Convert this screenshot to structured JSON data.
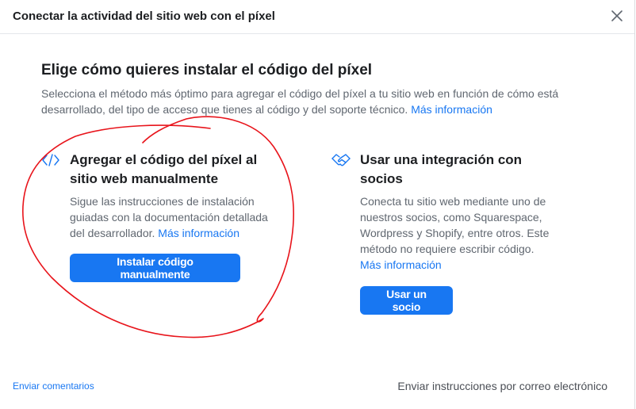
{
  "dialog": {
    "title": "Conectar la actividad del sitio web con el píxel"
  },
  "main": {
    "heading": "Elige cómo quieres instalar el código del píxel",
    "description": "Selecciona el método más óptimo para agregar el código del píxel a tu sitio web en función de cómo está desarrollado, del tipo de acceso que tienes al código y del soporte técnico.",
    "more_info": "Más información"
  },
  "options": {
    "manual": {
      "icon": "code-icon",
      "title": "Agregar el código del píxel al sitio web manualmente",
      "description": "Sigue las instrucciones de instalación guiadas con la documentación detallada del desarrollador.",
      "more_info": "Más información",
      "button": "Instalar código manualmente"
    },
    "partner": {
      "icon": "handshake-icon",
      "title": "Usar una integración con socios",
      "description": "Conecta tu sitio web mediante uno de nuestros socios, como Squarespace, Wordpress y Shopify, entre otros. Este método no requiere escribir código.",
      "more_info": "Más información",
      "button": "Usar un socio"
    }
  },
  "footer": {
    "feedback": "Enviar comentarios",
    "email_instructions": "Enviar instrucciones por correo electrónico"
  },
  "colors": {
    "accent": "#1877f2",
    "annotation": "#e8141b"
  }
}
